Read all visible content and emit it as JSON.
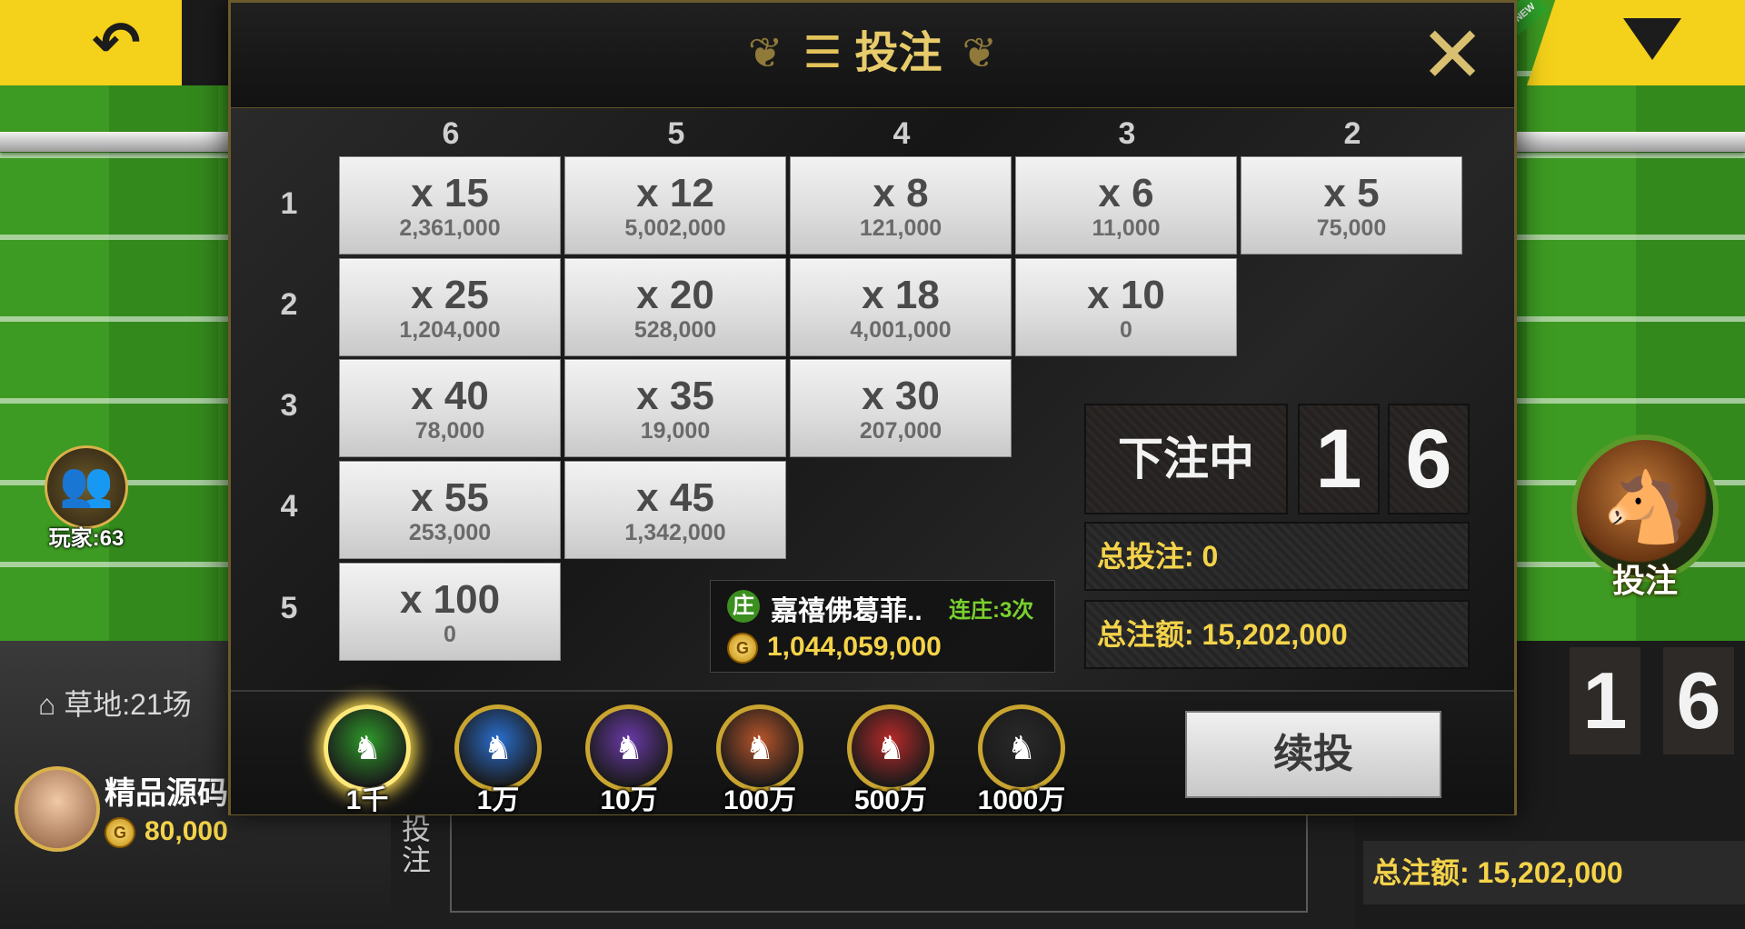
{
  "modal": {
    "title": "投注",
    "title_icon": "coin-stack-icon",
    "close_icon": "close-icon",
    "column_headers": [
      "6",
      "5",
      "4",
      "3",
      "2"
    ],
    "row_headers": [
      "1",
      "2",
      "3",
      "4",
      "5"
    ],
    "rows": [
      [
        {
          "mult": "x 15",
          "amount": "2,361,000"
        },
        {
          "mult": "x 12",
          "amount": "5,002,000"
        },
        {
          "mult": "x 8",
          "amount": "121,000"
        },
        {
          "mult": "x 6",
          "amount": "11,000"
        },
        {
          "mult": "x 5",
          "amount": "75,000"
        }
      ],
      [
        {
          "mult": "x 25",
          "amount": "1,204,000"
        },
        {
          "mult": "x 20",
          "amount": "528,000"
        },
        {
          "mult": "x 18",
          "amount": "4,001,000"
        },
        {
          "mult": "x 10",
          "amount": "0"
        }
      ],
      [
        {
          "mult": "x 40",
          "amount": "78,000"
        },
        {
          "mult": "x 35",
          "amount": "19,000"
        },
        {
          "mult": "x 30",
          "amount": "207,000"
        }
      ],
      [
        {
          "mult": "x 55",
          "amount": "253,000"
        },
        {
          "mult": "x 45",
          "amount": "1,342,000"
        }
      ],
      [
        {
          "mult": "x 100",
          "amount": "0"
        }
      ]
    ],
    "status": "下注中",
    "countdown": [
      "1",
      "6"
    ],
    "total_bet_label": "总投注: 0",
    "total_amount_label": "总注额: 15,202,000",
    "banker": {
      "tag": "庄",
      "name": "嘉禧佛葛菲..",
      "streak": "连庄:3次",
      "coins": "1,044,059,000"
    },
    "chips": [
      {
        "label": "1千",
        "color": "#2f9a2a",
        "selected": true
      },
      {
        "label": "1万",
        "color": "#2a6fd0",
        "selected": false
      },
      {
        "label": "10万",
        "color": "#6a3aa8",
        "selected": false
      },
      {
        "label": "100万",
        "color": "#b8562a",
        "selected": false
      },
      {
        "label": "500万",
        "color": "#b82a2a",
        "selected": false
      },
      {
        "label": "1000万",
        "color": "#2a2a2a",
        "selected": false
      }
    ],
    "rebet_label": "续投"
  },
  "background": {
    "players_label": "玩家:63",
    "bet_button_label": "投注",
    "field_label": "草地:21场",
    "username": "精品源码",
    "user_coins": "80,000",
    "side_text": "投注",
    "countdown": [
      "1",
      "6"
    ],
    "total_amount_label": "总注额: 15,202,000",
    "new_badge": "NEW"
  },
  "colors": {
    "accent_gold": "#e8cc6b",
    "top_bar_yellow": "#f4d11a",
    "coin_gold": "#f4d34a",
    "banker_green": "#3b8f1f"
  }
}
